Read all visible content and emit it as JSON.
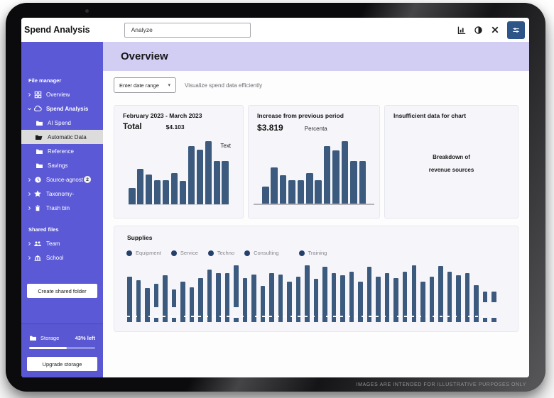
{
  "topbar": {
    "title": "Spend Analysis",
    "search_value": "Analyze",
    "icons": [
      "analytics-icon",
      "contrast-icon",
      "tools-icon",
      "preferences-icon"
    ]
  },
  "sidebar": {
    "section1_label": "File manager",
    "items": [
      {
        "label": "Overview",
        "icon": "grid-icon",
        "chevron": "right"
      },
      {
        "label": "Spend Analysis",
        "icon": "cloud-icon",
        "chevron": "down",
        "emph": true
      },
      {
        "label": "AI Spend",
        "icon": "folder-icon",
        "child": true
      },
      {
        "label": "Automatic Data",
        "icon": "folder-open-icon",
        "child": true,
        "selected": true
      },
      {
        "label": "Reference",
        "icon": "folder-icon",
        "child": true
      },
      {
        "label": "Savings",
        "icon": "folder-icon",
        "child": true
      },
      {
        "label": "Source-agnost",
        "icon": "clock-icon",
        "chevron": "right",
        "badge": "2"
      },
      {
        "label": "Taxonomy-",
        "icon": "star-icon",
        "chevron": "right"
      },
      {
        "label": "Trash bin",
        "icon": "trash-icon",
        "chevron": "right"
      }
    ],
    "section2_label": "Shared files",
    "shared_items": [
      {
        "label": "Team",
        "icon": "team-icon",
        "chevron": "right"
      },
      {
        "label": "School",
        "icon": "school-icon",
        "chevron": "right"
      }
    ],
    "create_button_label": "Create shared folder",
    "storage": {
      "label": "Storage",
      "icon": "folder-icon",
      "remaining_label": "43% left",
      "used_percent": 57
    },
    "upgrade_button_label": "Upgrade storage"
  },
  "main": {
    "header_title": "Overview",
    "date_range_label": "Enter date range",
    "subtitle": "Visualize spend data efficiently"
  },
  "chart_data": [
    {
      "id": "period-total",
      "type": "bar",
      "title": "February 2023 - March 2023",
      "total_label": "Total",
      "total_value": "$4.103",
      "annotation": "Text",
      "axes_hidden": true,
      "values": [
        26,
        56,
        47,
        38,
        38,
        50,
        37,
        92,
        87,
        100,
        68,
        68
      ]
    },
    {
      "id": "increase",
      "type": "bar",
      "title": "Increase from previous period",
      "value": "$3.819",
      "unit_label": "Percenta",
      "axes_hidden": true,
      "values": [
        27,
        58,
        45,
        38,
        38,
        49,
        38,
        92,
        85,
        100,
        68,
        68
      ]
    },
    {
      "id": "insufficient",
      "type": "empty",
      "title": "Insufficient data for chart",
      "message_lines": [
        "Breakdown of",
        "revenue sources"
      ]
    },
    {
      "id": "supplies",
      "type": "bar",
      "title": "Supplies",
      "legend": [
        "Equipment",
        "Service",
        "Techno",
        "Consulting",
        "Training"
      ],
      "axes_hidden": true,
      "values": [
        78,
        72,
        58,
        66,
        80,
        56,
        70,
        60,
        76,
        90,
        84,
        84,
        97,
        76,
        82,
        62,
        84,
        82,
        70,
        78,
        98,
        74,
        95,
        84,
        80,
        86,
        70,
        95,
        78,
        84,
        76,
        86,
        97,
        70,
        78,
        96,
        86,
        80,
        84,
        64,
        52,
        52
      ],
      "gap_bars": [
        4,
        6,
        13,
        41,
        42
      ]
    }
  ],
  "footer": {
    "disclaimer": "IMAGES ARE INTENDED FOR ILLUSTRATIVE PURPOSES ONLY"
  },
  "colors": {
    "sidebar": "#5b59d6",
    "header_band": "#d2cef3",
    "bar": "#3b5a7d",
    "legend_dot": "#24406b",
    "accent_button": "#2e5588",
    "selected_row": "#dcdcdd"
  }
}
